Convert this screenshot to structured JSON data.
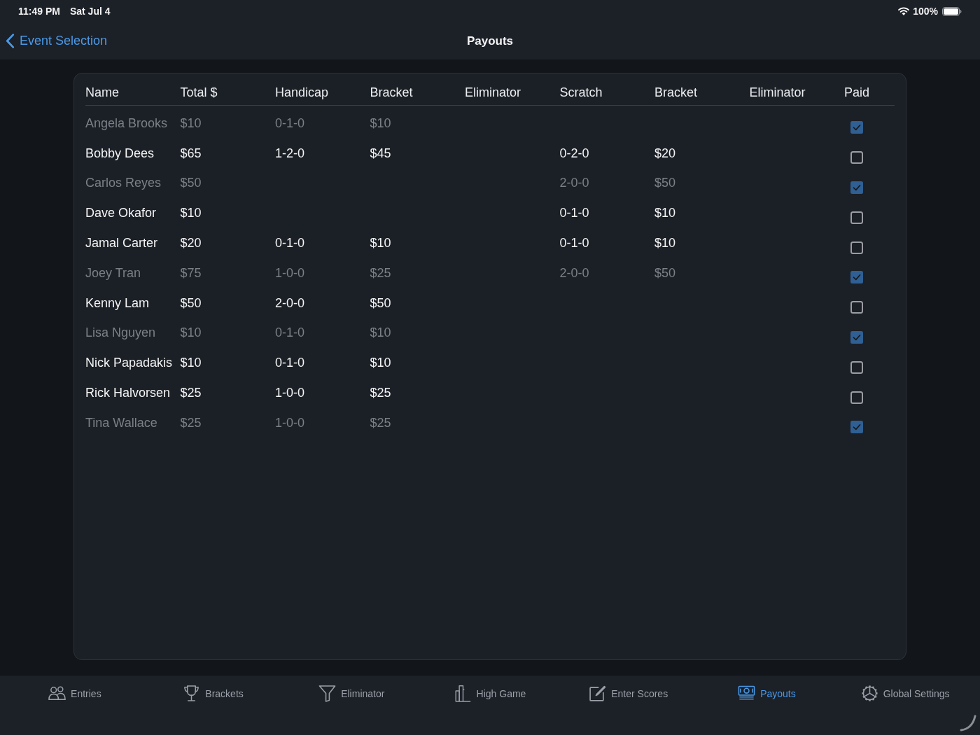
{
  "status_bar": {
    "time": "11:49 PM",
    "date": "Sat Jul 4",
    "battery": "100%"
  },
  "nav": {
    "back": "Event Selection",
    "title": "Payouts"
  },
  "table": {
    "columns": [
      "Name",
      "Total $",
      "Handicap",
      "Bracket",
      "Eliminator",
      "Scratch",
      "Bracket",
      "Eliminator",
      "Paid"
    ],
    "rows": [
      {
        "name": "Angela Brooks",
        "total": "$10",
        "handicap": "0-1-0",
        "handicap_bracket": "$10",
        "paid": true
      },
      {
        "name": "Bobby Dees",
        "total": "$65",
        "handicap": "1-2-0",
        "handicap_bracket": "$45",
        "scratch": "0-2-0",
        "scratch_bracket": "$20",
        "paid": false
      },
      {
        "name": "Carlos Reyes",
        "total": "$50",
        "scratch": "2-0-0",
        "scratch_bracket": "$50",
        "paid": true
      },
      {
        "name": "Dave Okafor",
        "total": "$10",
        "scratch": "0-1-0",
        "scratch_bracket": "$10",
        "paid": false
      },
      {
        "name": "Jamal Carter",
        "total": "$20",
        "handicap": "0-1-0",
        "handicap_bracket": "$10",
        "scratch": "0-1-0",
        "scratch_bracket": "$10",
        "paid": false
      },
      {
        "name": "Joey Tran",
        "total": "$75",
        "handicap": "1-0-0",
        "handicap_bracket": "$25",
        "scratch": "2-0-0",
        "scratch_bracket": "$50",
        "paid": true
      },
      {
        "name": "Kenny Lam",
        "total": "$50",
        "handicap": "2-0-0",
        "handicap_bracket": "$50",
        "paid": false
      },
      {
        "name": "Lisa Nguyen",
        "total": "$10",
        "handicap": "0-1-0",
        "handicap_bracket": "$10",
        "paid": true
      },
      {
        "name": "Nick Papadakis",
        "total": "$10",
        "handicap": "0-1-0",
        "handicap_bracket": "$10",
        "paid": false
      },
      {
        "name": "Rick Halvorsen",
        "total": "$25",
        "handicap": "1-0-0",
        "handicap_bracket": "$25",
        "paid": false
      },
      {
        "name": "Tina Wallace",
        "total": "$25",
        "handicap": "1-0-0",
        "handicap_bracket": "$25",
        "paid": true
      }
    ]
  },
  "tabs": [
    {
      "label": "Entries",
      "selected": false
    },
    {
      "label": "Brackets",
      "selected": false
    },
    {
      "label": "Eliminator",
      "selected": false
    },
    {
      "label": "High Game",
      "selected": false
    },
    {
      "label": "Enter Scores",
      "selected": false
    },
    {
      "label": "Payouts",
      "selected": true
    },
    {
      "label": "Global Settings",
      "selected": false
    }
  ]
}
